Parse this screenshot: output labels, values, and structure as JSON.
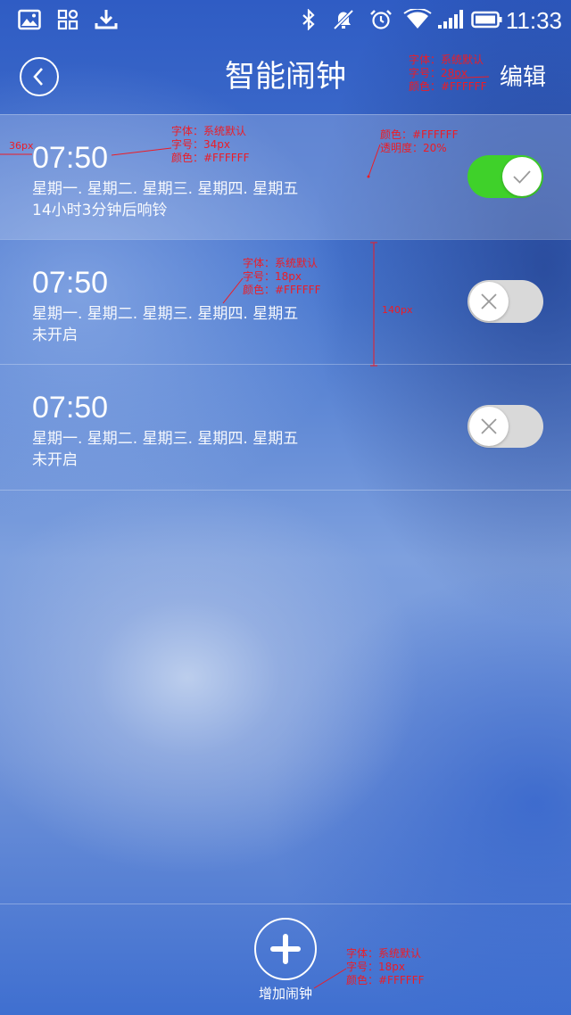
{
  "status_bar": {
    "time": "11:33",
    "icons": [
      "gallery-icon",
      "apps-icon",
      "download-icon",
      "bluetooth-icon",
      "mute-icon",
      "alarm-clock-icon",
      "wifi-icon",
      "signal-icon",
      "battery-icon"
    ]
  },
  "header": {
    "title": "智能闹钟",
    "edit_label": "编辑",
    "back_icon": "back-chevron-icon"
  },
  "alarms": [
    {
      "time": "07:50",
      "days": "星期一. 星期二. 星期三. 星期四. 星期五",
      "status": "14小时3分钟后响铃",
      "enabled": true
    },
    {
      "time": "07:50",
      "days": "星期一. 星期二. 星期三. 星期四. 星期五",
      "status": "未开启",
      "enabled": false
    },
    {
      "time": "07:50",
      "days": "星期一. 星期二. 星期三. 星期四. 星期五",
      "status": "未开启",
      "enabled": false
    }
  ],
  "bottom": {
    "add_label": "增加闹钟"
  },
  "annotations": {
    "header_spec": [
      "字体：系统默认",
      "字号：28px",
      "颜色：#FFFFFF"
    ],
    "time_spec": [
      "字体：系统默认",
      "字号：34px",
      "颜色：#FFFFFF"
    ],
    "row_bg_spec": [
      "颜色：#FFFFFF",
      "透明度：20%"
    ],
    "days_spec": [
      "字体：系统默认",
      "字号：18px",
      "颜色：#FFFFFF"
    ],
    "margin_label": "36px",
    "row_height_label": "140px",
    "add_spec": [
      "字体：系统默认",
      "字号：18px",
      "颜色：#FFFFFF"
    ]
  },
  "colors": {
    "toggle_on": "#3fd12a",
    "toggle_off": "#d9d9d9",
    "annotation": "#ee1c25",
    "text": "#FFFFFF"
  }
}
